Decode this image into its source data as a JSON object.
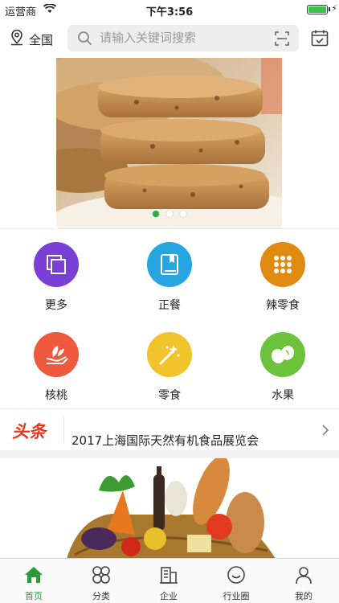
{
  "status_bar": {
    "carrier": "运营商",
    "time": "下午3:56"
  },
  "header": {
    "location_label": "全国",
    "search_placeholder": "请输入关键词搜索"
  },
  "banner": {
    "slides": 3,
    "active_index": 0
  },
  "categories": [
    {
      "label": "更多",
      "icon": "more-icon",
      "color": "#7a3fd6"
    },
    {
      "label": "正餐",
      "icon": "book-icon",
      "color": "#26a6e0"
    },
    {
      "label": "辣零食",
      "icon": "grid-dots-icon",
      "color": "#e08a12"
    },
    {
      "label": "核桃",
      "icon": "leaf-hand-icon",
      "color": "#ef5a3e"
    },
    {
      "label": "零食",
      "icon": "magic-wand-icon",
      "color": "#f2c42c"
    },
    {
      "label": "水果",
      "icon": "bean-icon",
      "color": "#6cc23a"
    }
  ],
  "headline": {
    "badge": "头条",
    "title": "2017上海国际天然有机食品展览会"
  },
  "tabbar": {
    "items": [
      {
        "label": "首页",
        "active": true
      },
      {
        "label": "分类",
        "active": false
      },
      {
        "label": "企业",
        "active": false
      },
      {
        "label": "行业圈",
        "active": false
      },
      {
        "label": "我的",
        "active": false
      }
    ]
  },
  "colors": {
    "accent": "#2a9a3a",
    "headline_badge": "#e8341a"
  }
}
